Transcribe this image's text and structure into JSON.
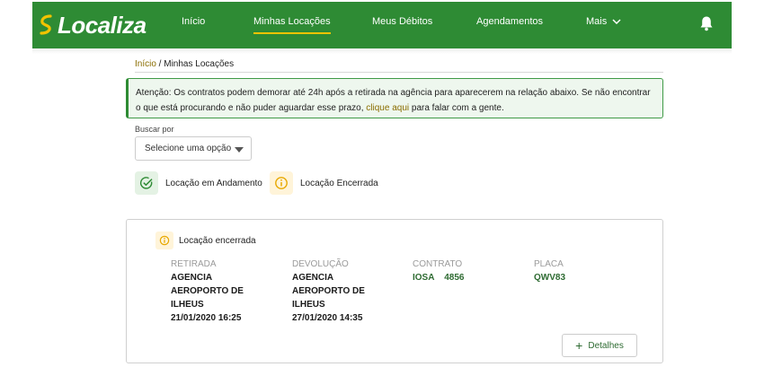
{
  "header": {
    "logo_text": "Localiza",
    "nav": [
      {
        "label": "Início"
      },
      {
        "label": "Minhas Locações"
      },
      {
        "label": "Meus Débitos"
      },
      {
        "label": "Agendamentos"
      },
      {
        "label": "Mais"
      }
    ],
    "icons": {
      "bell": "bell-icon",
      "more": "chevron-down-icon"
    }
  },
  "breadcrumb": {
    "home": "Início",
    "separator": " / ",
    "current": "Minhas Locações"
  },
  "alert": {
    "text_before": "Atenção: Os contratos podem demorar até 24h após a retirada na agência para aparecerem na relação abaixo. Se não encontrar o que está procurando e não puder aguardar esse prazo, ",
    "link": "clique aqui",
    "text_after": " para falar com a gente."
  },
  "search": {
    "label": "Buscar por",
    "selected": "Selecione uma opção"
  },
  "legend": [
    {
      "label": "Locação em Andamento",
      "icon": "check-circle-icon",
      "color": "#2e8b34"
    },
    {
      "label": "Locação Encerrada",
      "icon": "info-circle-icon",
      "color": "#e8a800"
    }
  ],
  "rental": {
    "status": "Locação encerrada",
    "pickup_label": "RETIRADA",
    "pickup_place": [
      "AGENCIA",
      "AEROPORTO DE",
      "ILHEUS"
    ],
    "pickup_date": "21/01/2020 16:25",
    "return_label": "DEVOLUÇÃO",
    "return_place": [
      "AGENCIA",
      "AEROPORTO DE",
      "ILHEUS"
    ],
    "return_date": "27/01/2020 14:35",
    "contract_label": "CONTRATO",
    "contract_value": "IOSA    4856",
    "plate_label": "PLACA",
    "plate_value": "QWV83",
    "details_label": "Detalhes"
  },
  "colors": {
    "brand": "#2e8b34",
    "accent": "#f2c300",
    "link": "#8a6d00"
  }
}
